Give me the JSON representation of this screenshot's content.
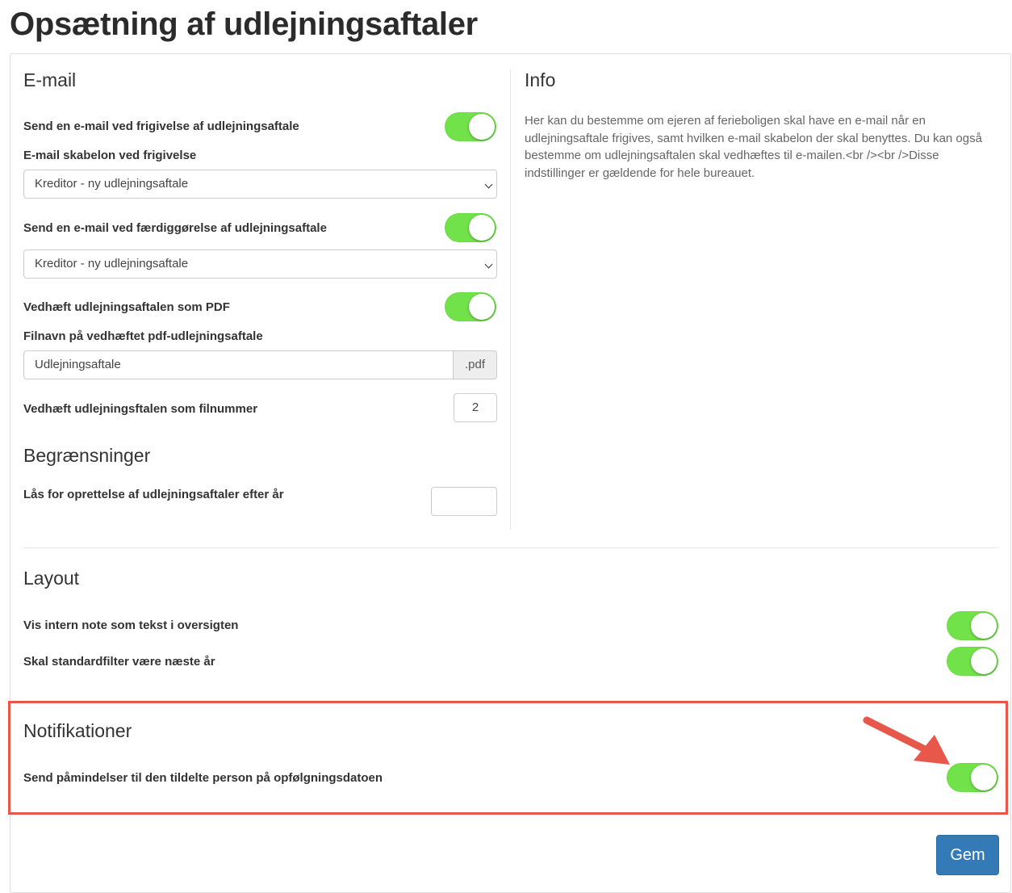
{
  "page": {
    "title": "Opsætning af udlejningsaftaler"
  },
  "email": {
    "title": "E-mail",
    "release_label": "Send en e-mail ved frigivelse af udlejningsaftale",
    "release_on": true,
    "template_label": "E-mail skabelon ved frigivelse",
    "template_value": "Kreditor - ny udlejningsaftale",
    "completion_label": "Send en e-mail ved færdiggørelse af udlejningsaftale",
    "completion_on": true,
    "completion_template_value": "Kreditor - ny udlejningsaftale",
    "attach_pdf_label": "Vedhæft udlejningsaftalen som PDF",
    "attach_pdf_on": true,
    "filename_label": "Filnavn på vedhæftet pdf-udlejningsaftale",
    "filename_value": "Udlejningsaftale",
    "filename_suffix": ".pdf",
    "file_number_label": "Vedhæft udlejningsftalen som filnummer",
    "file_number_value": "2"
  },
  "restrictions": {
    "title": "Begrænsninger",
    "lock_label": "Lås for oprettelse af udlejningsaftaler efter år",
    "lock_value": ""
  },
  "info": {
    "title": "Info",
    "text": "Her kan du bestemme om ejeren af ferieboligen skal have en e-mail når en udlejningsaftale frigives, samt hvilken e-mail skabelon der skal benyttes. Du kan også bestemme om udlejningsaftalen skal vedhæftes til e-mailen.<br /><br />Disse indstillinger er gældende for hele bureauet."
  },
  "layout": {
    "title": "Layout",
    "internal_note_label": "Vis intern note som tekst i oversigten",
    "internal_note_on": true,
    "default_filter_label": "Skal standardfilter være næste år",
    "default_filter_on": true
  },
  "notifications": {
    "title": "Notifikationer",
    "reminder_label": "Send påmindelser til den tildelte person på opfølgningsdatoen",
    "reminder_on": true
  },
  "actions": {
    "save_label": "Gem"
  },
  "colors": {
    "toggle_on": "#72e24a",
    "highlight": "#e8584a",
    "primary_button": "#337ab7"
  }
}
